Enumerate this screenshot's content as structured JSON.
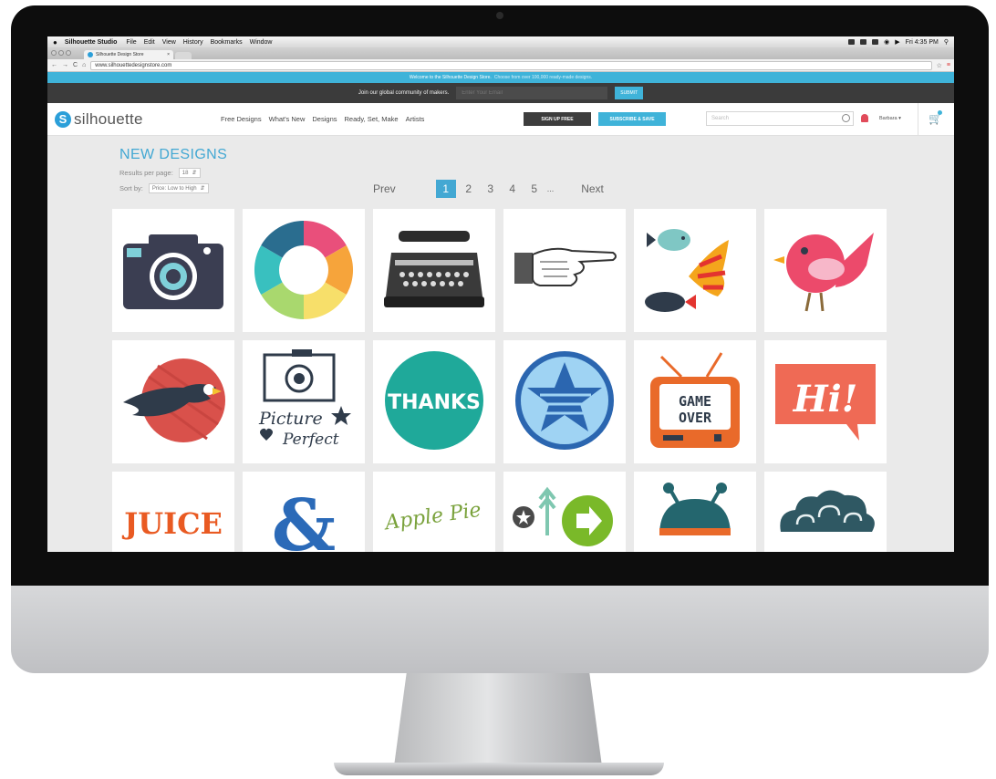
{
  "menubar": {
    "app": "Silhouette Studio",
    "items": [
      "File",
      "Edit",
      "View",
      "History",
      "Bookmarks",
      "Window"
    ],
    "clock": "Fri 4:35 PM"
  },
  "browser": {
    "tab_title": "Silhouette Design Store",
    "url": "www.silhouettedesignstore.com"
  },
  "banner": {
    "welcome": "Welcome to the Silhouette Design Store.",
    "tagline": "Choose from over 100,000 ready-made designs.",
    "join_text": "Join our global community of makers.",
    "email_placeholder": "Enter Your Email",
    "submit_label": "SUBMIT"
  },
  "nav": {
    "logo": "silhouette",
    "links": [
      "Free Designs",
      "What's New",
      "Designs",
      "Ready, Set, Make",
      "Artists"
    ],
    "signup_label": "SIGN UP FREE",
    "subscribe_label": "SUBSCRIBE & SAVE",
    "search_placeholder": "Search",
    "user": "Barbara"
  },
  "main": {
    "title": "NEW DESIGNS",
    "results_label": "Results per page:",
    "results_value": "18",
    "sort_label": "Sort by:",
    "sort_value": "Price: Low to High",
    "pager": {
      "prev": "Prev",
      "pages": [
        "1",
        "2",
        "3",
        "4",
        "5"
      ],
      "active": "1",
      "ellipsis": "...",
      "next": "Next"
    },
    "tile_texts": {
      "thanks": "THANKS",
      "game": "GAME",
      "over": "OVER",
      "hi": "Hi!",
      "picture": "Picture",
      "perfect": "Perfect",
      "juice": "JUICE",
      "apple_pie": "Apple Pie"
    }
  },
  "colors": {
    "accent": "#43a8d3",
    "banner_blue": "#3fb3d9",
    "dark_bar": "#3b3b3b"
  }
}
